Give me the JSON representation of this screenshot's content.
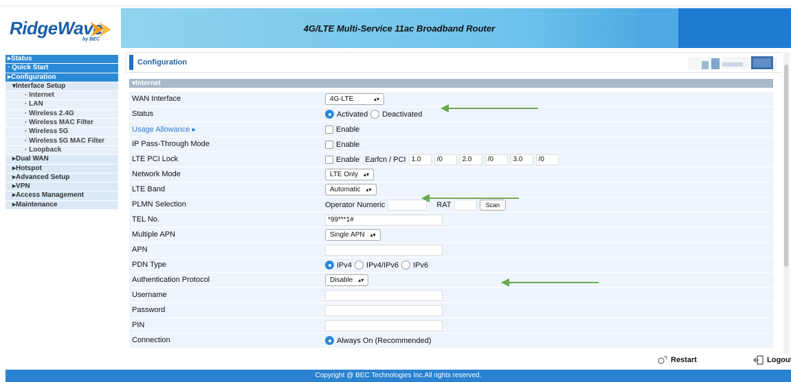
{
  "brand": {
    "name": "RidgeWave",
    "by": "by BEC"
  },
  "header": {
    "title": "4G/LTE Multi-Service 11ac Broadband Router"
  },
  "nav": [
    {
      "label": "▸Status",
      "style": "blue"
    },
    {
      "label": "· Quick Start",
      "style": "blue"
    },
    {
      "label": "▸Configuration",
      "style": "blue"
    },
    {
      "label": "▾Interface Setup",
      "style": "sub1"
    },
    {
      "label": "· Internet",
      "style": "sub2"
    },
    {
      "label": "· LAN",
      "style": "sub2"
    },
    {
      "label": "· Wireless 2.4G",
      "style": "sub2"
    },
    {
      "label": "· Wireless MAC Filter",
      "style": "sub2"
    },
    {
      "label": "· Wireless 5G",
      "style": "sub2"
    },
    {
      "label": "· Wireless 5G MAC Filter",
      "style": "sub2"
    },
    {
      "label": "· Loopback",
      "style": "sub2"
    },
    {
      "label": "▸Dual WAN",
      "style": "sub1"
    },
    {
      "label": "▸Hotspot",
      "style": "sub1"
    },
    {
      "label": "▸Advanced Setup",
      "style": "sub1"
    },
    {
      "label": "▸VPN",
      "style": "sub1"
    },
    {
      "label": "▸Access Management",
      "style": "sub1"
    },
    {
      "label": "▸Maintenance",
      "style": "sub1"
    }
  ],
  "page": {
    "title": "Configuration",
    "section": "▾Internet"
  },
  "form": {
    "wan_interface": {
      "label": "WAN Interface",
      "value": "4G-LTE"
    },
    "status": {
      "label": "Status",
      "opt1": "Activated",
      "opt2": "Deactivated"
    },
    "usage": {
      "label": "Usage Allowance ▸",
      "enable": "Enable"
    },
    "ip_pass": {
      "label": "IP Pass-Through Mode",
      "enable": "Enable"
    },
    "pci_lock": {
      "label": "LTE PCI Lock",
      "enable": "Enable",
      "earfcn_label": "Earfcn / PCI",
      "v1": "1.0",
      "v2": "/0",
      "v3": "2.0",
      "v4": "/0",
      "v5": "3.0",
      "v6": "/0"
    },
    "network_mode": {
      "label": "Network Mode",
      "value": "LTE Only"
    },
    "lte_band": {
      "label": "LTE Band",
      "value": "Automatic"
    },
    "plmn": {
      "label": "PLMN Selection",
      "operator": "Operator Numeric",
      "rat": "RAT",
      "scan": "Scan"
    },
    "tel": {
      "label": "TEL No.",
      "value": "*99***1#"
    },
    "multi_apn": {
      "label": "Multiple APN",
      "value": "Single APN"
    },
    "apn": {
      "label": "APN",
      "value": ""
    },
    "pdn": {
      "label": "PDN Type",
      "opt1": "IPv4",
      "opt2": "IPv4/IPv6",
      "opt3": "IPv6"
    },
    "auth": {
      "label": "Authentication Protocol",
      "value": "Disable"
    },
    "username": {
      "label": "Username",
      "value": ""
    },
    "password": {
      "label": "Password",
      "value": ""
    },
    "pin": {
      "label": "PIN",
      "value": ""
    },
    "connection": {
      "label": "Connection",
      "value": "Always On (Recommended)"
    }
  },
  "actions": {
    "restart": "Restart",
    "logout": "Logout"
  },
  "footer": {
    "text": "Copyright @ BEC Technologies Inc.All rights reserved."
  },
  "colors": {
    "header_blue": "#6cc2ec",
    "nav_blue": "#2a8ad8",
    "arrow_green": "#6aa84f",
    "footer_blue": "#2a82d0"
  }
}
